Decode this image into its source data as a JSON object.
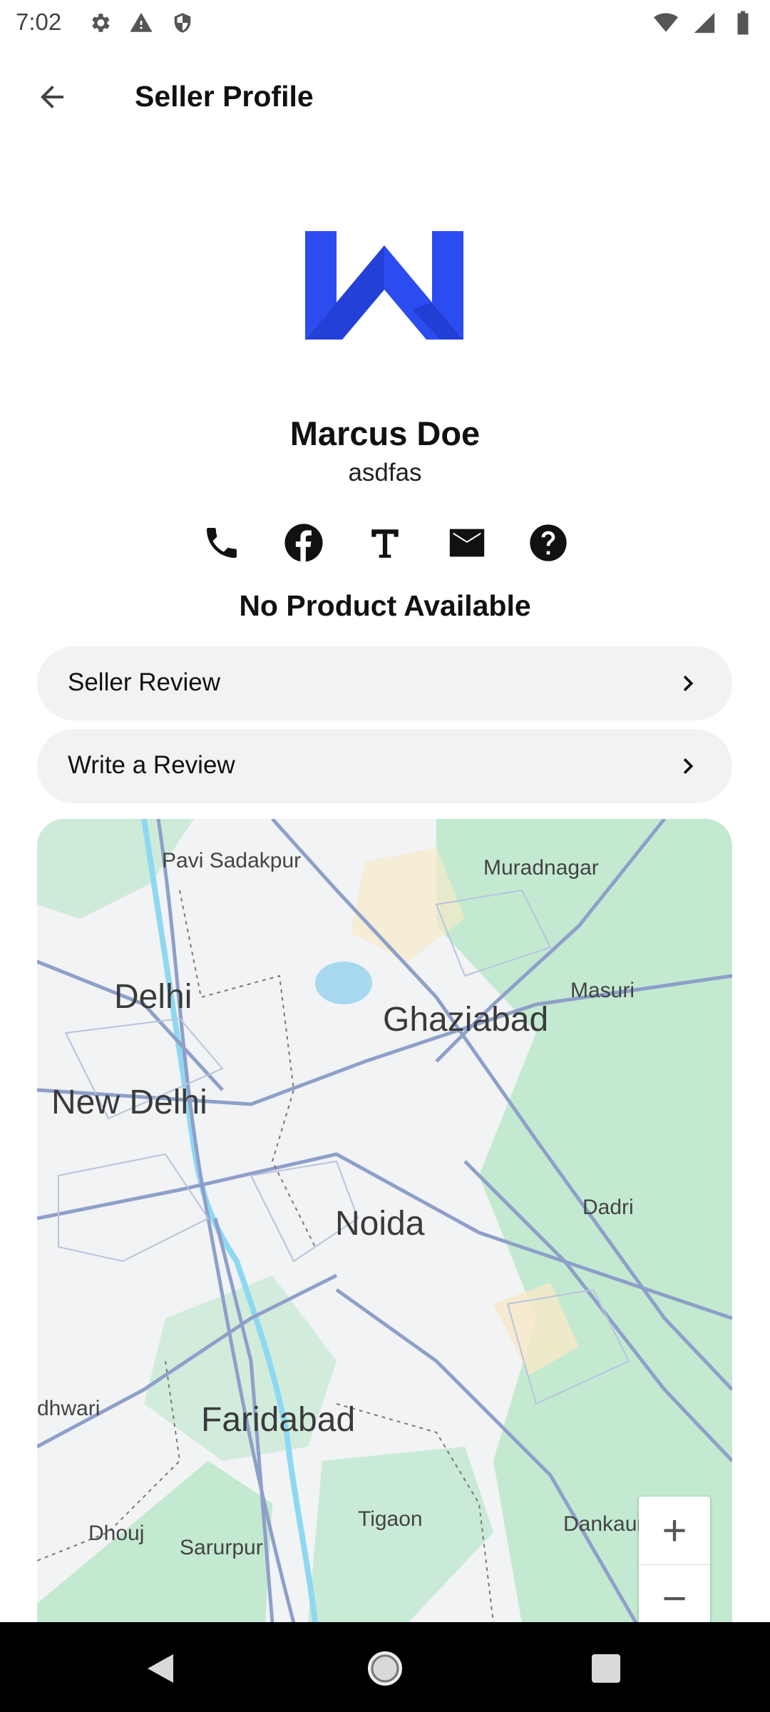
{
  "status_bar": {
    "time": "7:02",
    "icons_left": [
      "gear-icon",
      "warning-icon",
      "shield-icon"
    ],
    "icons_right": [
      "wifi-icon",
      "signal-icon",
      "battery-icon"
    ]
  },
  "app_bar": {
    "title": "Seller Profile",
    "back_icon": "arrow-back-icon"
  },
  "profile": {
    "logo": "w-logo",
    "name": "Marcus Doe",
    "subtitle": "asdfas"
  },
  "contact_icons": [
    "phone-icon",
    "facebook-icon",
    "text-t-icon",
    "mail-icon",
    "help-icon"
  ],
  "products": {
    "empty_message": "No Product Available"
  },
  "actions": {
    "seller_review": "Seller Review",
    "write_review": "Write a Review"
  },
  "map": {
    "labels": {
      "pavi_sadakpur": "Pavi Sadakpur",
      "muradnagar": "Muradnagar",
      "delhi": "Delhi",
      "masuri": "Masuri",
      "ghaziabad": "Ghaziabad",
      "new_delhi": "New Delhi",
      "dadri": "Dadri",
      "noida": "Noida",
      "dhwari": "dhwari",
      "faridabad": "Faridabad",
      "tigaon": "Tigaon",
      "dankaur": "Dankaur",
      "dhouj": "Dhouj",
      "sarurpur": "Sarurpur"
    },
    "zoom_in": "+",
    "zoom_out": "−"
  },
  "nav_bar": {
    "back": "nav-back-icon",
    "home": "nav-home-icon",
    "recents": "nav-recents-icon"
  },
  "colors": {
    "logo_blue": "#2b4cf0",
    "logo_dark": "#1e36c2",
    "map_green": "#b8e6c8",
    "map_water": "#8fd8f2",
    "map_road": "#8e9fc9"
  }
}
